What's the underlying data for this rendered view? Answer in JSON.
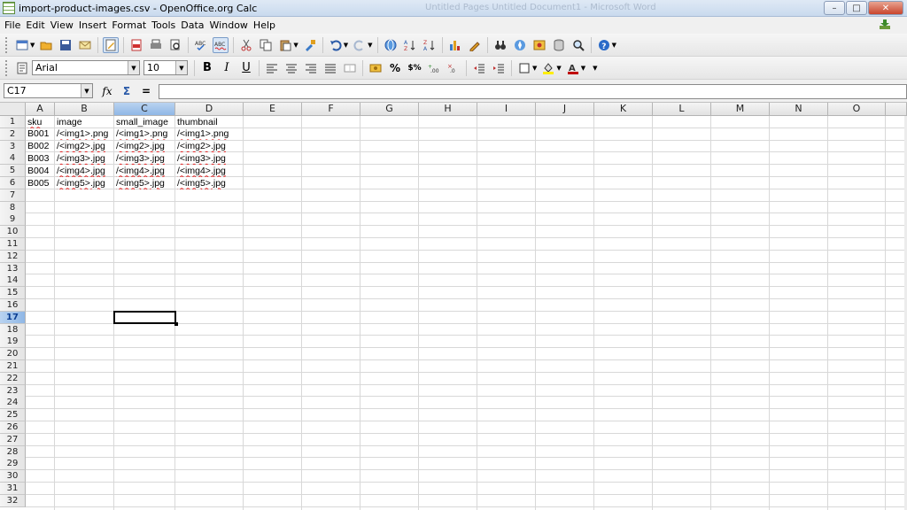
{
  "window": {
    "title": "import-product-images.csv - OpenOffice.org Calc",
    "ghost_title": "Untitled Pages   Untitled   Document1 - Microsoft Word",
    "buttons": {
      "minimize": "–",
      "maximize": "□",
      "close": "✕"
    }
  },
  "menu": [
    "File",
    "Edit",
    "View",
    "Insert",
    "Format",
    "Tools",
    "Data",
    "Window",
    "Help"
  ],
  "formatting": {
    "font_name": "Arial",
    "font_size": "10",
    "bold": "B",
    "italic": "I",
    "underline": "U",
    "percent": "%",
    "currency_label": "$%"
  },
  "formula_bar": {
    "name_box": "C17",
    "function_icon": "fx",
    "sum_icon": "Σ",
    "equals_icon": "=",
    "content": ""
  },
  "columns": [
    "A",
    "B",
    "C",
    "D",
    "E",
    "F",
    "G",
    "H",
    "I",
    "J",
    "K",
    "L",
    "M",
    "N",
    "O"
  ],
  "active_column": "C",
  "active_row": 17,
  "row_count": 32,
  "cells": {
    "header": [
      "sku",
      "image",
      "small_image",
      "thumbnail"
    ],
    "rows": [
      [
        "B001",
        "/<img1>.png",
        "/<img1>.png",
        "/<img1>.png"
      ],
      [
        "B002",
        "/<img2>.jpg",
        "/<img2>.jpg",
        "/<img2>.jpg"
      ],
      [
        "B003",
        "/<img3>.jpg",
        "/<img3>.jpg",
        "/<img3>.jpg"
      ],
      [
        "B004",
        "/<img4>.jpg",
        "/<img4>.jpg",
        "/<img4>.jpg"
      ],
      [
        "B005",
        "/<img5>.jpg",
        "/<img5>.jpg",
        "/<img5>.jpg"
      ]
    ]
  },
  "colors": {
    "accent": "#8fb7e6",
    "spell_underline": "#e02020"
  }
}
